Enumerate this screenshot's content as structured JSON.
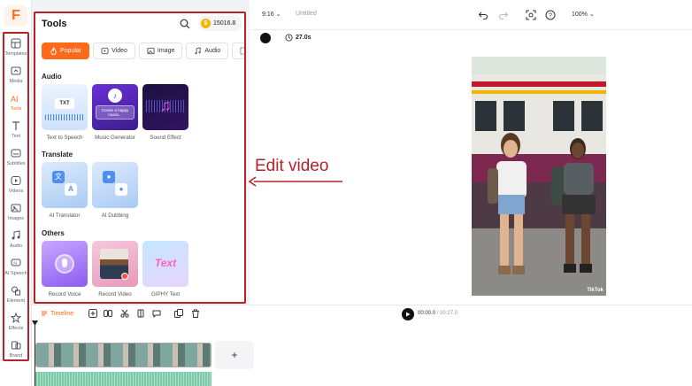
{
  "app": {
    "logo_letter": "F"
  },
  "sidebar": {
    "items": [
      {
        "label": "Templates",
        "icon": "templates-icon"
      },
      {
        "label": "Media",
        "icon": "media-icon"
      },
      {
        "label": "Tools",
        "icon": "tools-icon",
        "active": true
      },
      {
        "label": "Text",
        "icon": "text-icon"
      },
      {
        "label": "Subtitles",
        "icon": "subtitles-icon"
      },
      {
        "label": "Videos",
        "icon": "videos-icon"
      },
      {
        "label": "Images",
        "icon": "images-icon"
      },
      {
        "label": "Audio",
        "icon": "audio-icon"
      },
      {
        "label": "AI Speech",
        "icon": "ai-speech-icon"
      },
      {
        "label": "Element",
        "icon": "element-icon"
      },
      {
        "label": "Effects",
        "icon": "effects-icon"
      },
      {
        "label": "Brand",
        "icon": "brand-icon"
      }
    ]
  },
  "panel": {
    "title": "Tools",
    "credits": "15016.8",
    "tabs": [
      {
        "label": "Popular",
        "active": true
      },
      {
        "label": "Video"
      },
      {
        "label": "Image"
      },
      {
        "label": "Audio"
      },
      {
        "label": "T"
      }
    ],
    "sections": [
      {
        "title": "Audio",
        "tools": [
          {
            "label": "Text to Speech",
            "thumb_text": "TXT"
          },
          {
            "label": "Music Generator",
            "thumb_text": "Create a happy music..."
          },
          {
            "label": "Sound Effect"
          }
        ]
      },
      {
        "title": "Translate",
        "tools": [
          {
            "label": "AI Translator"
          },
          {
            "label": "AI Dubbing"
          }
        ]
      },
      {
        "title": "Others",
        "tools": [
          {
            "label": "Record Voice"
          },
          {
            "label": "Record Video"
          },
          {
            "label": "GIPHY Text",
            "thumb_text": "Text"
          }
        ]
      }
    ]
  },
  "topbar": {
    "ratio": "9:16",
    "title": "Untitled",
    "zoom": "100%"
  },
  "canvas": {
    "duration": "27.0s",
    "watermark": "TikTok"
  },
  "annotation": {
    "text": "Edit video"
  },
  "timeline": {
    "label": "Timeline",
    "current_time": "00:00.0",
    "total_time": "/ 00:27.0",
    "add_label": "+"
  },
  "colors": {
    "accent": "#ff6a1a",
    "annotation": "#b5222a"
  }
}
